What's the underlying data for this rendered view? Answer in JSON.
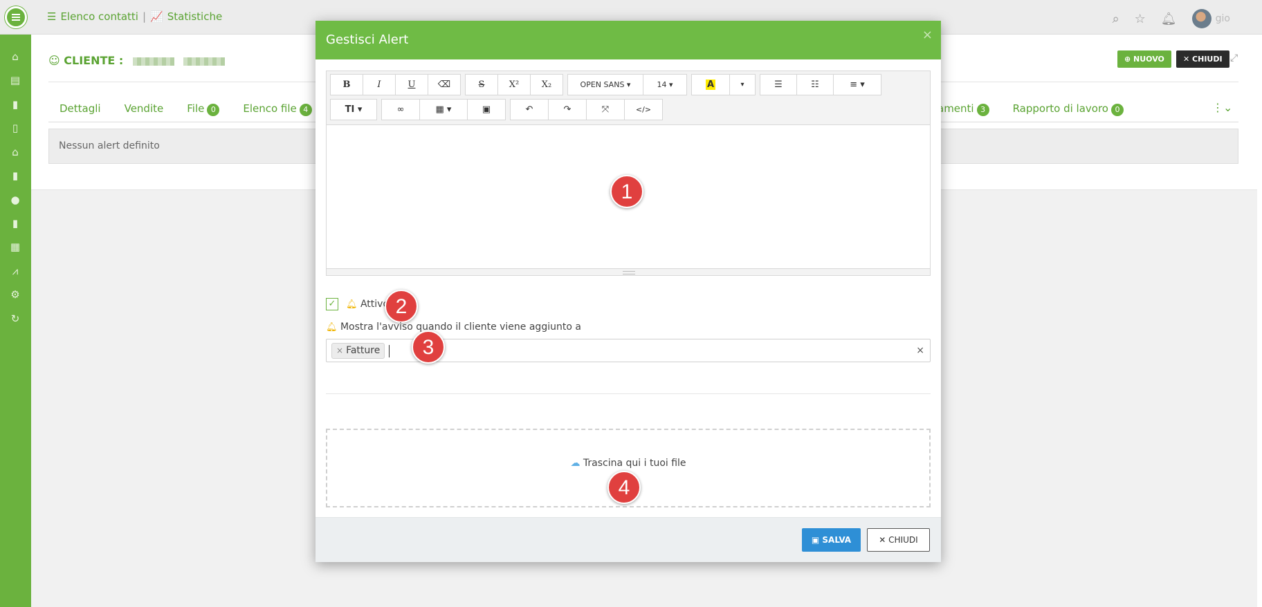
{
  "topnav": {
    "contacts_label": "Elenco contatti",
    "separator": "|",
    "stats_label": "Statistiche"
  },
  "user": {
    "name": "gio"
  },
  "page": {
    "client_label": "CLIENTE :",
    "tabs": [
      {
        "label": "Dettagli"
      },
      {
        "label": "Vendite"
      },
      {
        "label": "File",
        "badge": "0"
      },
      {
        "label": "Elenco file",
        "badge": "4"
      }
    ],
    "tabs_right": [
      {
        "label": "amenti",
        "badge": "3"
      },
      {
        "label": "Rapporto di lavoro",
        "badge": "0"
      }
    ],
    "no_alert_text": "Nessun alert definito",
    "new_button": "NUOVO",
    "close_button": "CHIUDI"
  },
  "modal": {
    "title": "Gestisci Alert",
    "toolbar": {
      "font_name": "OPEN SANS",
      "font_size": "14"
    },
    "active_label": "Attivo",
    "active_checked": true,
    "show_when_label": "Mostra l'avviso quando il cliente viene aggiunto a",
    "tag_value": "Fatture",
    "dropzone_text": "Trascina qui i tuoi file",
    "save_button": "SALVA",
    "close_button": "CHIUDI"
  },
  "markers": [
    "1",
    "2",
    "3",
    "4"
  ],
  "colors": {
    "brand_green": "#6bb23e",
    "header_green": "#6fbb45",
    "save_blue": "#2e8fd6",
    "marker_red": "#e0403f"
  }
}
